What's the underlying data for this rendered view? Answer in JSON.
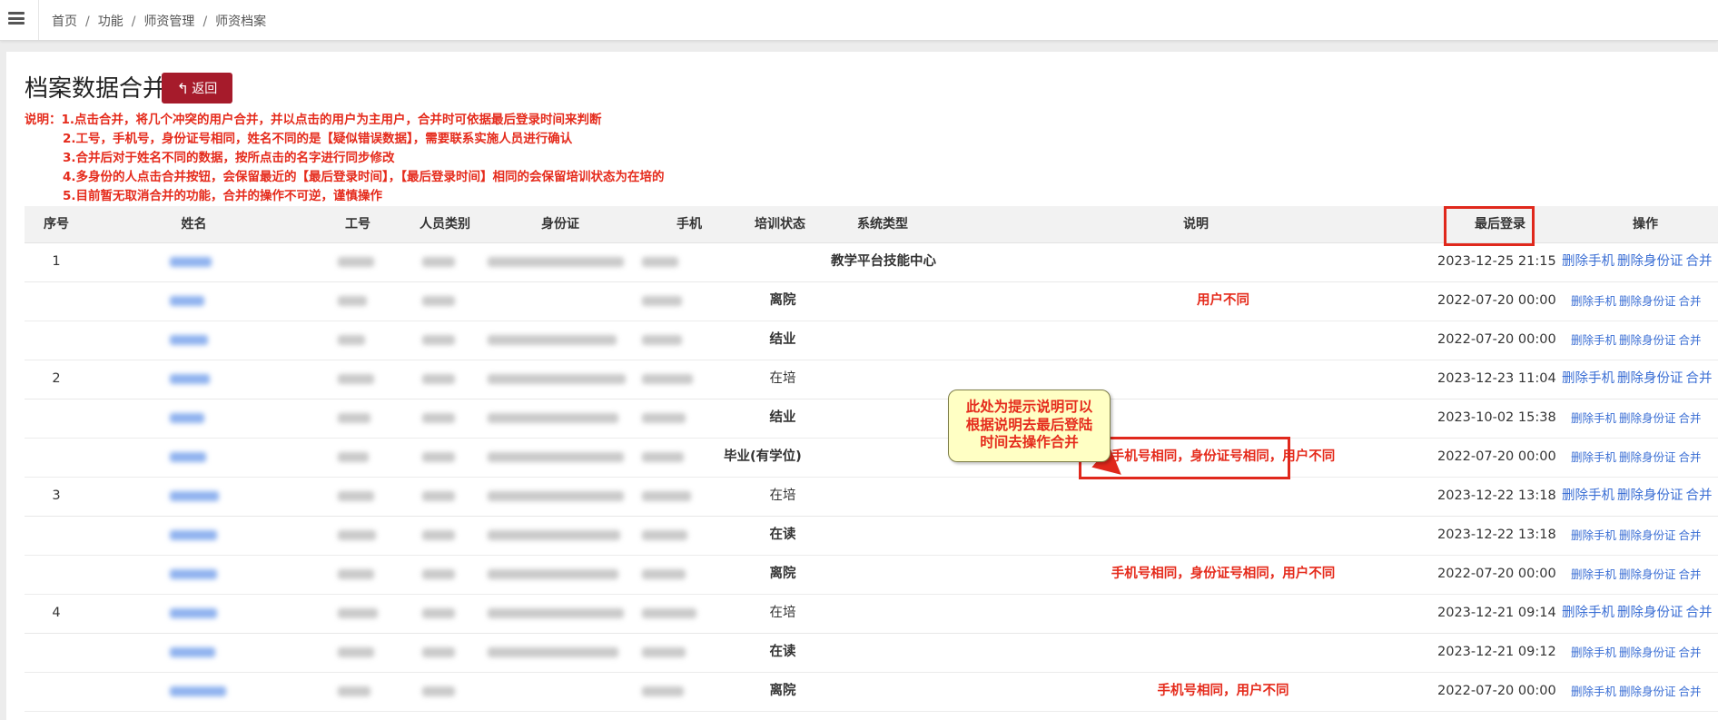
{
  "breadcrumb": [
    "首页",
    "功能",
    "师资管理",
    "师资档案"
  ],
  "page": {
    "title": "档案数据合并",
    "back_label": "返回"
  },
  "notes": [
    "说明：1.点击合并，将几个冲突的用户合并，并以点击的用户为主用户，合并时可依据最后登录时间来判断",
    "2.工号，手机号，身份证号相同，姓名不同的是【疑似错误数据】，需要联系实施人员进行确认",
    "3.合并后对于姓名不同的数据，按所点击的名字进行同步修改",
    "4.多身份的人点击合并按钮，会保留最近的【最后登录时间】，【最后登录时间】相同的会保留培训状态为在培的",
    "5.目前暂无取消合并的功能，合并的操作不可逆，谨慎操作"
  ],
  "table": {
    "headers": [
      "序号",
      "姓名",
      "工号",
      "人员类别",
      "身份证",
      "手机",
      "培训状态",
      "系统类型",
      "说明",
      "最后登录",
      "操作"
    ],
    "operations": [
      "删除手机",
      "删除身份证",
      "合并"
    ],
    "rows": [
      {
        "seq": "1",
        "status": "",
        "system": "教学平台技能中心",
        "desc": "",
        "time": "2023-12-25 21:15"
      },
      {
        "seq": "",
        "status": "离院",
        "system": "",
        "desc": "用户不同",
        "time": "2022-07-20 00:00"
      },
      {
        "seq": "",
        "status": "结业",
        "system": "",
        "desc": "",
        "time": "2022-07-20 00:00"
      },
      {
        "seq": "2",
        "status": "在培",
        "system": "",
        "desc": "",
        "time": "2023-12-23 11:04"
      },
      {
        "seq": "",
        "status": "结业",
        "system": "",
        "desc": "",
        "time": "2023-10-02 15:38"
      },
      {
        "seq": "",
        "status": "毕业(有学位)",
        "system": "",
        "desc": "手机号相同，身份证号相同，用户不同",
        "time": "2022-07-20 00:00"
      },
      {
        "seq": "3",
        "status": "在培",
        "system": "",
        "desc": "",
        "time": "2023-12-22 13:18"
      },
      {
        "seq": "",
        "status": "在读",
        "system": "",
        "desc": "",
        "time": "2023-12-22 13:18"
      },
      {
        "seq": "",
        "status": "离院",
        "system": "",
        "desc": "手机号相同，身份证号相同，用户不同",
        "time": "2022-07-20 00:00"
      },
      {
        "seq": "4",
        "status": "在培",
        "system": "",
        "desc": "",
        "time": "2023-12-21 09:14"
      },
      {
        "seq": "",
        "status": "在读",
        "system": "",
        "desc": "",
        "time": "2023-12-21 09:12"
      },
      {
        "seq": "",
        "status": "离院",
        "system": "",
        "desc": "手机号相同，用户不同",
        "time": "2022-07-20 00:00"
      }
    ]
  },
  "callout": {
    "text": [
      "此处为提示说明可以",
      "根据说明去最后登陆",
      "时间去操作合并"
    ]
  },
  "colors": {
    "accent": "#a61b2b",
    "warning_text": "#e52b1c",
    "link": "#3a6ed4",
    "callout_bg": "#ffffc4"
  },
  "icons": {
    "menu": "hamburger-menu-icon",
    "back": "reply-arrow-icon"
  }
}
